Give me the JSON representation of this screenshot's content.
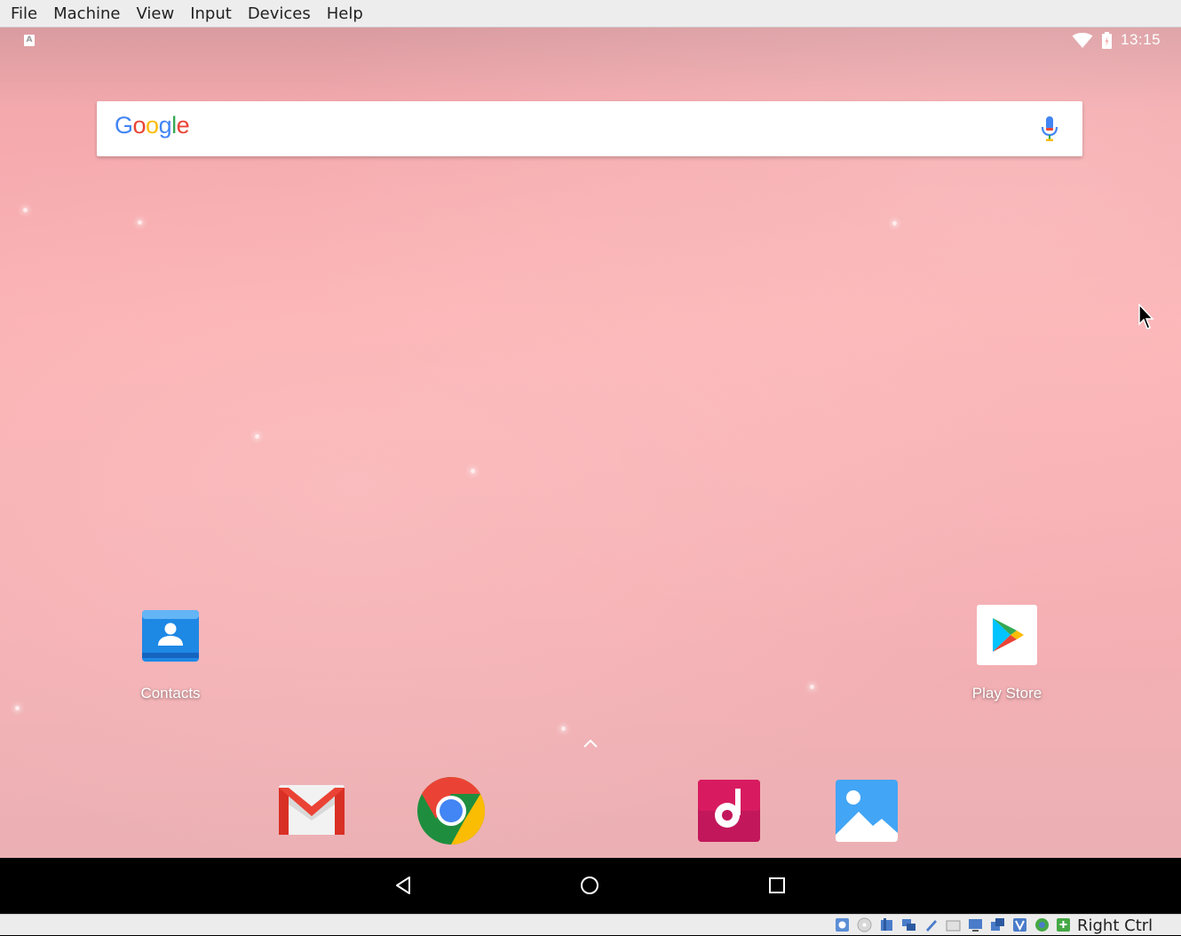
{
  "window": {
    "menu": [
      "File",
      "Machine",
      "View",
      "Input",
      "Devices",
      "Help"
    ]
  },
  "statusbar": {
    "notification_icon": "A",
    "clock": "13:15",
    "icons": [
      "wifi-icon",
      "battery-icon"
    ]
  },
  "search": {
    "logo": {
      "G": "G",
      "o1": "o",
      "o2": "o",
      "g": "g",
      "l": "l",
      "e": "e"
    },
    "logo_colors": [
      "#4285F4",
      "#EA4335",
      "#FBBC05",
      "#4285F4",
      "#34A853",
      "#EA4335"
    ],
    "mic_icon": "mic-icon"
  },
  "home": {
    "apps": [
      {
        "label": "Contacts",
        "icon": "contacts-icon"
      },
      {
        "label": "Play Store",
        "icon": "play-store-icon"
      }
    ],
    "drawer_arrow": "chevron-up-icon"
  },
  "dock": [
    "gmail-icon",
    "chrome-icon",
    "music-icon",
    "gallery-icon"
  ],
  "navbar": [
    "back-icon",
    "home-icon",
    "recents-icon"
  ],
  "vbox_status": {
    "host_key": "Right Ctrl"
  },
  "colors": {
    "wallpaper": "#f8aeb1",
    "menubar": "#ededed",
    "navbar": "#000000"
  }
}
